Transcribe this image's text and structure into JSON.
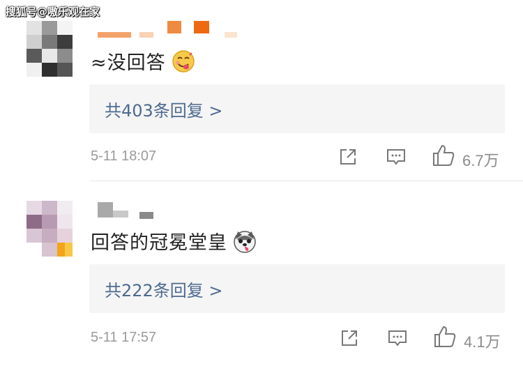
{
  "watermark": "搜狐号@嗷乐观在家",
  "comments": [
    {
      "text": "≈没回答",
      "emoji": "tongue-smile-emoji",
      "reply_label": "共403条回复 >",
      "time": "5-11 18:07",
      "likes": "6.7万"
    },
    {
      "text": "回答的冠冕堂皇",
      "emoji": "husky-dog-emoji",
      "reply_label": "共222条回复 >",
      "time": "5-11 17:57",
      "likes": "4.1万"
    }
  ],
  "icons": {
    "share": "share-icon",
    "comment": "comment-icon",
    "like": "thumbs-up-icon"
  },
  "colors": {
    "link": "#4d6a8f",
    "meta": "#9a9a9a",
    "reply_bg": "#f5f5f5"
  }
}
